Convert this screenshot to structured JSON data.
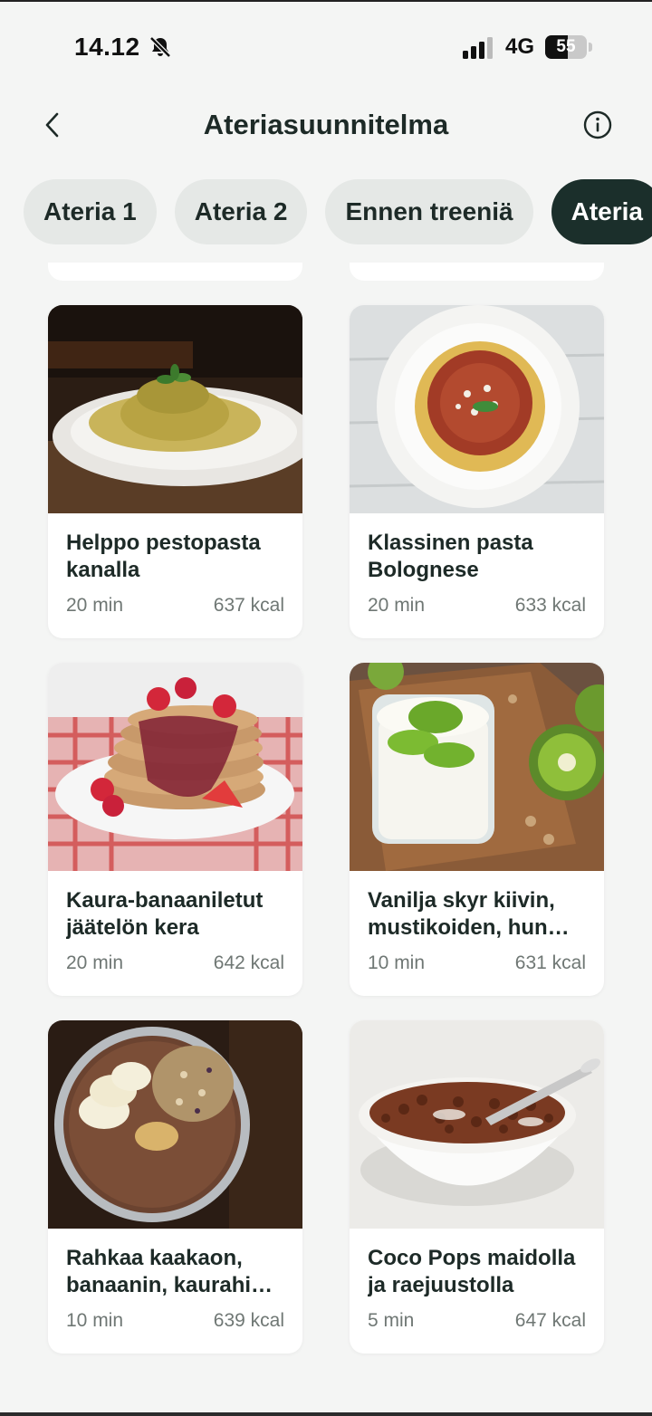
{
  "status": {
    "time": "14.12",
    "network": "4G",
    "battery": "55",
    "battery_level": 0.55
  },
  "header": {
    "title": "Ateriasuunnitelma",
    "back_icon": "chevron-left-icon",
    "info_icon": "info-icon"
  },
  "tabs": [
    {
      "label": "Ateria 1",
      "active": false
    },
    {
      "label": "Ateria 2",
      "active": false
    },
    {
      "label": "Ennen treeniä",
      "active": false
    },
    {
      "label": "Ateria",
      "active": true
    }
  ],
  "recipes": [
    {
      "title": "Helppo pestopasta kanalla",
      "time": "20 min",
      "kcal": "637 kcal",
      "image": "pesto-pasta"
    },
    {
      "title": "Klassinen pasta Bolognese",
      "time": "20 min",
      "kcal": "633 kcal",
      "image": "pasta-bolognese"
    },
    {
      "title": "Kaura-banaaniletut jäätelön kera",
      "time": "20 min",
      "kcal": "642 kcal",
      "image": "pancakes"
    },
    {
      "title": "Vanilja skyr kiivin, mustikoiden, hun…",
      "time": "10 min",
      "kcal": "631 kcal",
      "image": "skyr-kiwi"
    },
    {
      "title": "Rahkaa kaakaon, banaanin, kaurahi…",
      "time": "10 min",
      "kcal": "639 kcal",
      "image": "cocoa-bowl"
    },
    {
      "title": "Coco Pops maidolla ja raejuustolla",
      "time": "5 min",
      "kcal": "647 kcal",
      "image": "coco-pops"
    }
  ],
  "colors": {
    "background": "#f4f5f4",
    "accent": "#1b2f2b",
    "tab_inactive": "#e5e8e6",
    "text_primary": "#1d2a27",
    "text_secondary": "#6f7774"
  }
}
